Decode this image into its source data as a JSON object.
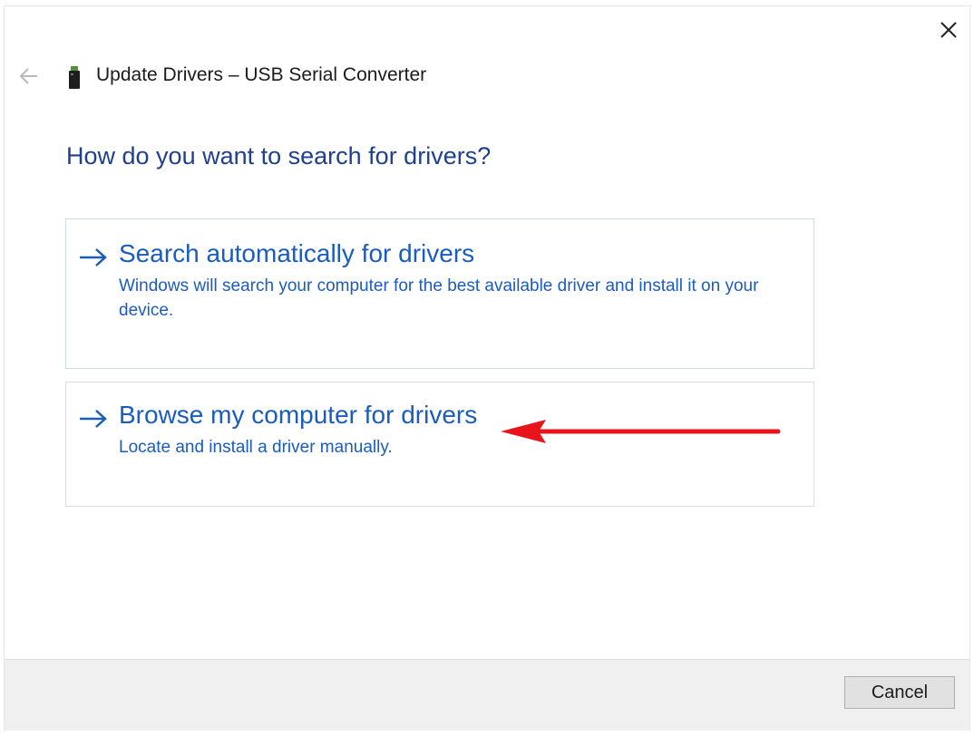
{
  "window": {
    "title": "Update Drivers – USB Serial Converter"
  },
  "heading": "How do you want to search for drivers?",
  "options": [
    {
      "title": "Search automatically for drivers",
      "description": "Windows will search your computer for the best available driver and install it on your device."
    },
    {
      "title": "Browse my computer for drivers",
      "description": "Locate and install a driver manually."
    }
  ],
  "footer": {
    "cancel_label": "Cancel"
  },
  "icons": {
    "close": "close-icon",
    "back": "back-arrow-icon",
    "device": "usb-device-icon",
    "option_arrow": "right-arrow-icon",
    "annotation": "red-annotation-arrow-icon"
  },
  "colors": {
    "heading": "#1f3f91",
    "link": "#1a5cc0",
    "annotation": "#e8141c",
    "footer_bg": "#f0f0f0"
  }
}
